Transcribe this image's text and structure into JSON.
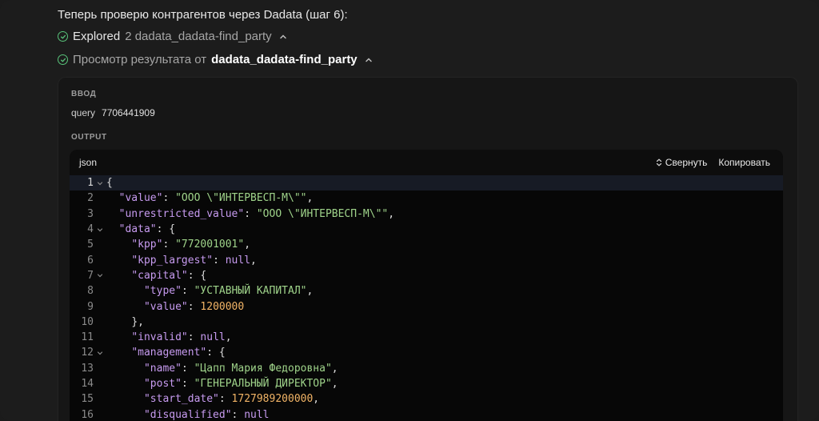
{
  "intro": "Теперь проверю контрагентов через Dadata (шаг 6):",
  "steps": [
    {
      "label_bold": "Explored",
      "label_rest": "2 dadata_dadata-find_party"
    },
    {
      "label_rest": "Просмотр результата от",
      "label_bold": "dadata_dadata-find_party"
    }
  ],
  "input": {
    "section_label": "ВВОД",
    "key": "query",
    "value": "7706441909"
  },
  "output": {
    "section_label": "OUTPUT"
  },
  "code": {
    "language": "json",
    "collapse_label": "Свернуть",
    "copy_label": "Копировать",
    "lines": [
      {
        "n": "1",
        "fold": true,
        "indent": "",
        "k": "",
        "v": "",
        "t": "p",
        "p": "{"
      },
      {
        "n": "2",
        "indent": "  ",
        "k": "\"value\"",
        "v": "\"ООО \\\"ИНТЕРВЕСП-М\\\"\"",
        "t": "s",
        "p": ","
      },
      {
        "n": "3",
        "indent": "  ",
        "k": "\"unrestricted_value\"",
        "v": "\"ООО \\\"ИНТЕРВЕСП-М\\\"\"",
        "t": "s",
        "p": ","
      },
      {
        "n": "4",
        "fold": true,
        "indent": "  ",
        "k": "\"data\"",
        "v": "{",
        "t": "p",
        "p": ""
      },
      {
        "n": "5",
        "indent": "    ",
        "k": "\"kpp\"",
        "v": "\"772001001\"",
        "t": "s",
        "p": ","
      },
      {
        "n": "6",
        "indent": "    ",
        "k": "\"kpp_largest\"",
        "v": "null",
        "t": "n",
        "p": ","
      },
      {
        "n": "7",
        "fold": true,
        "indent": "    ",
        "k": "\"capital\"",
        "v": "{",
        "t": "p",
        "p": ""
      },
      {
        "n": "8",
        "indent": "      ",
        "k": "\"type\"",
        "v": "\"УСТАВНЫЙ КАПИТАЛ\"",
        "t": "s",
        "p": ","
      },
      {
        "n": "9",
        "indent": "      ",
        "k": "\"value\"",
        "v": "1200000",
        "t": "d",
        "p": ""
      },
      {
        "n": "10",
        "indent": "    ",
        "k": "",
        "v": "",
        "t": "p",
        "p": "},"
      },
      {
        "n": "11",
        "indent": "    ",
        "k": "\"invalid\"",
        "v": "null",
        "t": "n",
        "p": ","
      },
      {
        "n": "12",
        "fold": true,
        "indent": "    ",
        "k": "\"management\"",
        "v": "{",
        "t": "p",
        "p": ""
      },
      {
        "n": "13",
        "indent": "      ",
        "k": "\"name\"",
        "v": "\"Цапп Мария Федоровна\"",
        "t": "s",
        "p": ","
      },
      {
        "n": "14",
        "indent": "      ",
        "k": "\"post\"",
        "v": "\"ГЕНЕРАЛЬНЫЙ ДИРЕКТОР\"",
        "t": "s",
        "p": ","
      },
      {
        "n": "15",
        "indent": "      ",
        "k": "\"start_date\"",
        "v": "1727989200000",
        "t": "d",
        "p": ","
      },
      {
        "n": "16",
        "indent": "      ",
        "k": "\"disqualified\"",
        "v": "null",
        "t": "n",
        "p": ""
      }
    ]
  },
  "colors": {
    "check": "#58c37a",
    "key": "#c79bf0",
    "string": "#9fd38a",
    "number": "#f2b466"
  }
}
